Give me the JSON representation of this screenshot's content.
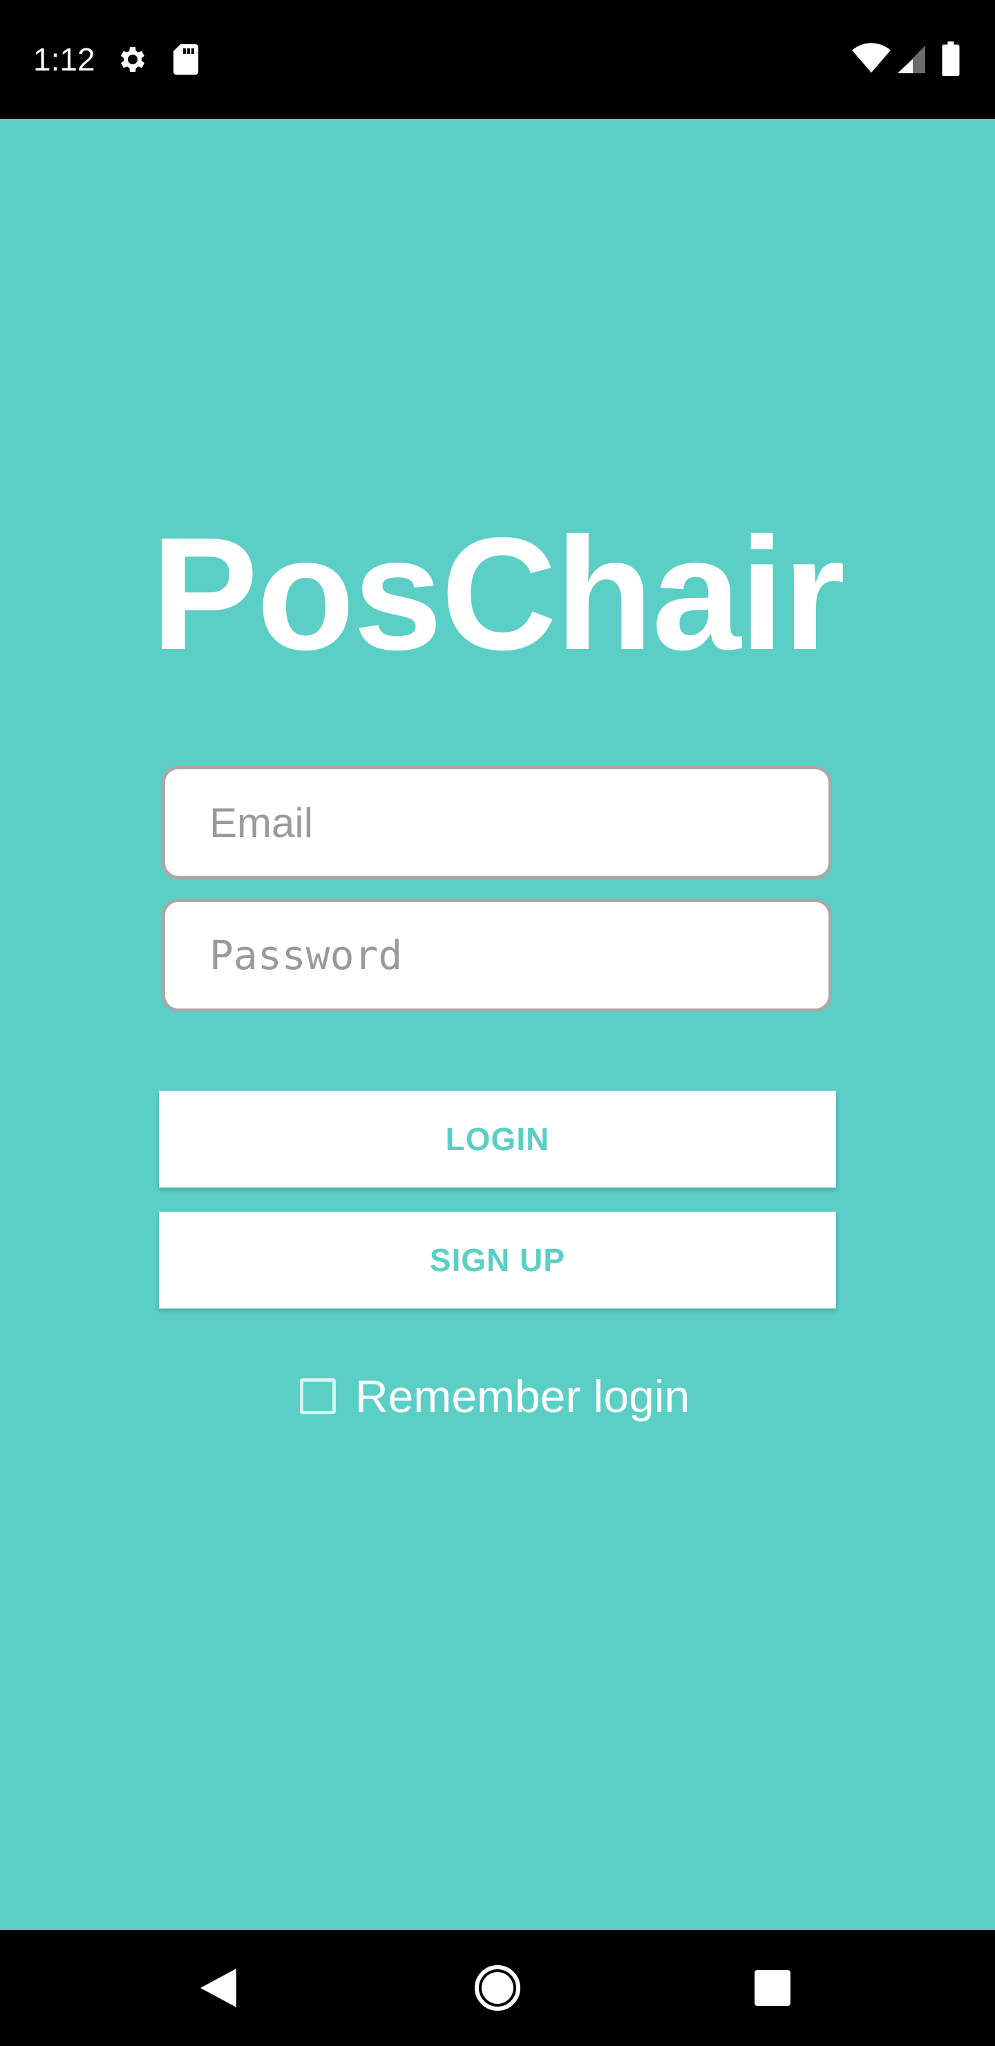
{
  "status_bar": {
    "time": "1:12",
    "icons": [
      "gear-icon",
      "sd-card-icon",
      "wifi-icon",
      "signal-icon",
      "battery-icon"
    ]
  },
  "app": {
    "title": "PosChair"
  },
  "form": {
    "email_placeholder": "Email",
    "password_placeholder": "Password",
    "login_label": "LOGIN",
    "signup_label": "SIGN UP",
    "remember_label": "Remember login",
    "remember_checked": false
  },
  "nav_bar": {
    "icons": [
      "back-icon",
      "home-icon",
      "recents-icon"
    ]
  },
  "colors": {
    "background": "#5BCEC6",
    "accent_text": "#5BCEC6",
    "bars": "#000000",
    "input_border": "#A8A8A8"
  }
}
